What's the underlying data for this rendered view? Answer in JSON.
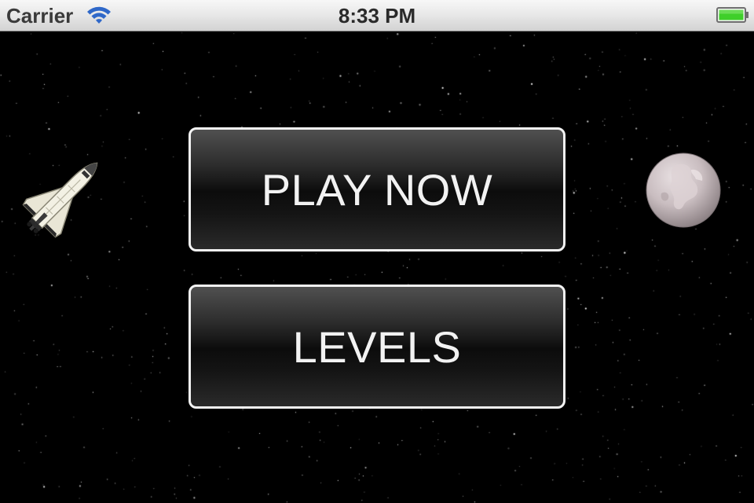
{
  "status_bar": {
    "carrier": "Carrier",
    "time": "8:33 PM",
    "wifi_icon": "wifi-icon",
    "battery_icon": "battery-icon",
    "battery_level": 1.0,
    "battery_color": "#3fcf2a"
  },
  "menu": {
    "play_label": "PLAY NOW",
    "levels_label": "LEVELS",
    "button_border_color": "#f4f4f4",
    "button_text_color": "#f2f2f2"
  },
  "sprites": {
    "shuttle_icon": "space-shuttle-icon",
    "moon_icon": "moon-icon"
  },
  "background": {
    "color": "#000000",
    "star_color": "#ffffff"
  }
}
